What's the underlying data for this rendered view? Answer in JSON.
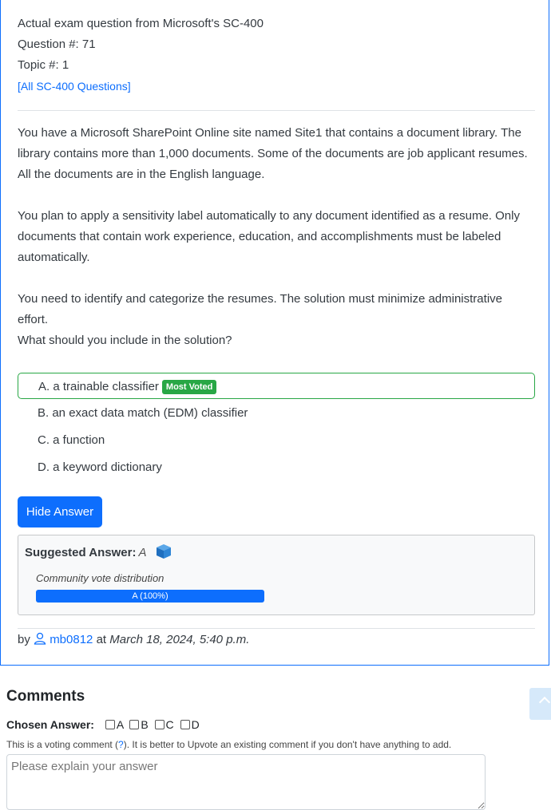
{
  "header": {
    "exam_line": "Actual exam question from Microsoft's SC-400",
    "question_line": "Question #: 71",
    "topic_line": "Topic #: 1",
    "all_link": "[All SC-400 Questions]"
  },
  "question": {
    "paragraphs": [
      "You have a Microsoft SharePoint Online site named Site1 that contains a document library. The library contains more than 1,000 documents. Some of the documents are job applicant resumes. All the documents are in the English language.",
      "You plan to apply a sensitivity label automatically to any document identified as a resume. Only documents that contain work experience, education, and accomplishments must be labeled automatically.",
      "You need to identify and categorize the resumes. The solution must minimize administrative effort.",
      "What should you include in the solution?"
    ]
  },
  "choices": [
    {
      "label": "A. a trainable classifier",
      "badge": "Most Voted"
    },
    {
      "label": "B. an exact data match (EDM) classifier"
    },
    {
      "label": "C. a function"
    },
    {
      "label": "D. a keyword dictionary"
    }
  ],
  "answer_button": "Hide Answer",
  "suggested": {
    "title": "Suggested Answer:",
    "answer": "A",
    "vote_label": "Community vote distribution",
    "vote_bar_text": "A (100%)",
    "vote_fraction": 1.0
  },
  "byline": {
    "by": "by",
    "user": "mb0812",
    "at": "at",
    "date": "March 18, 2024, 5:40 p.m."
  },
  "comments": {
    "title": "Comments",
    "chosen_label": "Chosen Answer:",
    "options": [
      "A",
      "B",
      "C",
      "D"
    ],
    "help_prefix": "This is a voting comment (",
    "help_link": "?",
    "help_suffix": "). It is better to Upvote an existing comment if you don't have anything to add.",
    "placeholder": "Please explain your answer"
  },
  "colors": {
    "accent": "#0d6efd",
    "most_voted_green": "#28a745"
  },
  "icons": {
    "user": "user-icon",
    "answer": "cube-icon",
    "scroll": "chevron-up-icon"
  }
}
